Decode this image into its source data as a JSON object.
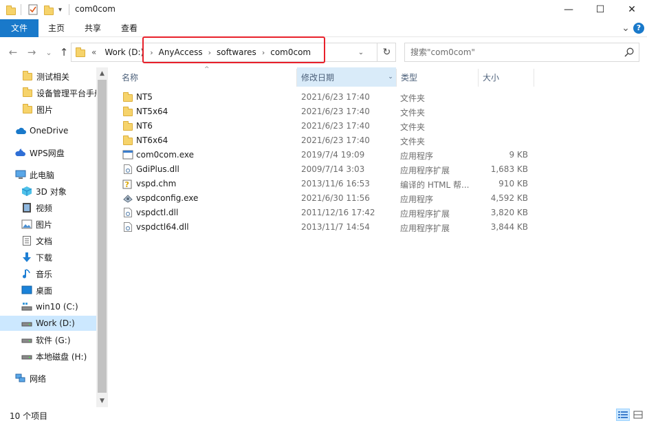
{
  "window": {
    "title": "com0com",
    "min_glyph": "—",
    "max_glyph": "☐",
    "close_glyph": "✕",
    "qa_dropdown_glyph": "▾"
  },
  "ribbon": {
    "tabs": [
      {
        "label": "文件"
      },
      {
        "label": "主页"
      },
      {
        "label": "共享"
      },
      {
        "label": "查看"
      }
    ],
    "expand_glyph": "⌄",
    "help_glyph": "?"
  },
  "nav": {
    "back_glyph": "←",
    "forward_glyph": "→",
    "recent_glyph": "⌄",
    "up_glyph": "↑",
    "overflow_glyph": "«",
    "breadcrumbs": [
      "Work (D:)",
      "AnyAccess",
      "softwares",
      "com0com"
    ],
    "chevron_glyph": "›",
    "dropdown_glyph": "⌄",
    "refresh_glyph": "↻",
    "search_placeholder": "搜索\"com0com\""
  },
  "sidebar": {
    "items": [
      {
        "label": "测试相关",
        "icon": "folder-icon"
      },
      {
        "label": "设备管理平台手册",
        "icon": "folder-icon"
      },
      {
        "label": "图片",
        "icon": "folder-icon"
      },
      {
        "label": "OneDrive",
        "icon": "cloud-icon"
      },
      {
        "label": "WPS网盘",
        "icon": "cloud-icon"
      },
      {
        "label": "此电脑",
        "icon": "computer-icon"
      },
      {
        "label": "3D 对象",
        "icon": "cube-icon"
      },
      {
        "label": "视频",
        "icon": "video-icon"
      },
      {
        "label": "图片",
        "icon": "picture-icon"
      },
      {
        "label": "文档",
        "icon": "document-icon"
      },
      {
        "label": "下载",
        "icon": "download-icon"
      },
      {
        "label": "音乐",
        "icon": "music-icon"
      },
      {
        "label": "桌面",
        "icon": "desktop-icon"
      },
      {
        "label": "win10 (C:)",
        "icon": "drive-icon"
      },
      {
        "label": "Work (D:)",
        "icon": "drive-icon",
        "selected": true
      },
      {
        "label": "软件 (G:)",
        "icon": "drive-icon"
      },
      {
        "label": "本地磁盘 (H:)",
        "icon": "drive-icon"
      },
      {
        "label": "网络",
        "icon": "network-icon"
      }
    ],
    "scroll_up_glyph": "▲",
    "scroll_down_glyph": "▼"
  },
  "columns": {
    "name": "名称",
    "date": "修改日期",
    "type": "类型",
    "size": "大小",
    "sort_glyph": "^",
    "drop_glyph": "⌄"
  },
  "files": [
    {
      "name": "NT5",
      "date": "2021/6/23 17:40",
      "type": "文件夹",
      "size": "",
      "icon": "folder-icon"
    },
    {
      "name": "NT5x64",
      "date": "2021/6/23 17:40",
      "type": "文件夹",
      "size": "",
      "icon": "folder-icon"
    },
    {
      "name": "NT6",
      "date": "2021/6/23 17:40",
      "type": "文件夹",
      "size": "",
      "icon": "folder-icon"
    },
    {
      "name": "NT6x64",
      "date": "2021/6/23 17:40",
      "type": "文件夹",
      "size": "",
      "icon": "folder-icon"
    },
    {
      "name": "com0com.exe",
      "date": "2019/7/4 19:09",
      "type": "应用程序",
      "size": "9 KB",
      "icon": "exe-icon"
    },
    {
      "name": "GdiPlus.dll",
      "date": "2009/7/14 3:03",
      "type": "应用程序扩展",
      "size": "1,683 KB",
      "icon": "dll-icon"
    },
    {
      "name": "vspd.chm",
      "date": "2013/11/6 16:53",
      "type": "编译的 HTML 帮...",
      "size": "910 KB",
      "icon": "help-file-icon"
    },
    {
      "name": "vspdconfig.exe",
      "date": "2021/6/30 11:56",
      "type": "应用程序",
      "size": "4,592 KB",
      "icon": "config-exe-icon"
    },
    {
      "name": "vspdctl.dll",
      "date": "2011/12/16 17:42",
      "type": "应用程序扩展",
      "size": "3,820 KB",
      "icon": "dll-icon"
    },
    {
      "name": "vspdctl64.dll",
      "date": "2013/11/7 14:54",
      "type": "应用程序扩展",
      "size": "3,844 KB",
      "icon": "dll-icon"
    }
  ],
  "status": {
    "item_count": "10 个项目"
  },
  "colors": {
    "accent": "#1979ca",
    "selection": "#cce8ff",
    "highlight_box": "#e8202a",
    "folder": "#f6d36b"
  }
}
